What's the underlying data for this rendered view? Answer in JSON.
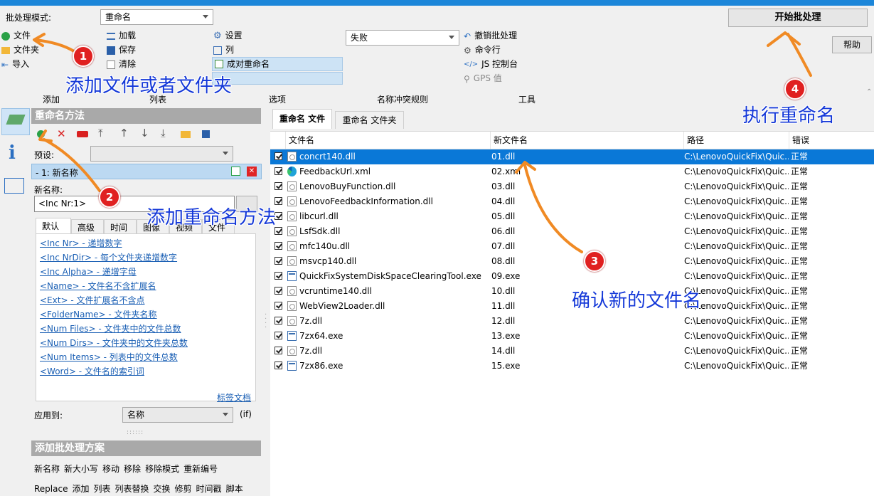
{
  "ribbon": {
    "batch_mode_label": "批处理模式:",
    "batch_mode_value": "重命名",
    "add_group": {
      "items": [
        "文件",
        "文件夹",
        "导入"
      ],
      "caption": "添加"
    },
    "list_group": {
      "items": [
        "加载",
        "保存",
        "清除"
      ],
      "caption": "列表"
    },
    "options_group": {
      "items": [
        "设置",
        "列",
        "成对重命名"
      ],
      "caption": "选项"
    },
    "conflict_group": {
      "value": "失败",
      "caption": "名称冲突规则"
    },
    "tools_group": {
      "items": [
        "撤销批处理",
        "命令行",
        "JS 控制台",
        "GPS 值"
      ],
      "caption": "工具"
    },
    "start_button": "开始批处理",
    "help_button": "帮助"
  },
  "methods": {
    "title": "重命名方法",
    "preset_label": "预设:",
    "method_item": "-  1: 新名称",
    "new_name_label": "新名称:",
    "new_name_value": "<Inc Nr:1>",
    "tabs": [
      "默认",
      "高级",
      "时间",
      "图像",
      "视频",
      "文件"
    ],
    "tags": [
      "<Inc Nr> - 递增数字",
      "<Inc NrDir> - 每个文件夹递增数字",
      "<Inc Alpha> - 递增字母",
      "<Name> - 文件名不含扩展名",
      "<Ext> - 文件扩展名不含点",
      "<FolderName> - 文件夹名称",
      "<Num Files> - 文件夹中的文件总数",
      "<Num Dirs> - 文件夹中的文件夹总数",
      "<Num Items> - 列表中的文件总数",
      "<Word> - 文件名的索引词"
    ],
    "tag_docs": "标签文档",
    "apply_to_label": "应用到:",
    "apply_to_value": "名称",
    "if_label": "(if)"
  },
  "schemes": {
    "title": "添加批处理方案",
    "row1": [
      "新名称",
      "新大小写",
      "移动",
      "移除",
      "移除模式",
      "重新编号"
    ],
    "row2": [
      "Replace",
      "添加",
      "列表",
      "列表替换",
      "交换",
      "修剪",
      "时间戳",
      "脚本"
    ]
  },
  "file_tabs": [
    "重命名 文件",
    "重命名 文件夹"
  ],
  "table": {
    "headers": [
      "文件名",
      "新文件名",
      "路径",
      "错误"
    ],
    "rows": [
      {
        "name": "concrt140.dll",
        "new": "01.dll",
        "path": "C:\\LenovoQuickFix\\Quic...",
        "err": "正常",
        "icon": "dll"
      },
      {
        "name": "FeedbackUrl.xml",
        "new": "02.xml",
        "path": "C:\\LenovoQuickFix\\Quic...",
        "err": "正常",
        "icon": "edge"
      },
      {
        "name": "LenovoBuyFunction.dll",
        "new": "03.dll",
        "path": "C:\\LenovoQuickFix\\Quic...",
        "err": "正常",
        "icon": "dll"
      },
      {
        "name": "LenovoFeedbackInformation.dll",
        "new": "04.dll",
        "path": "C:\\LenovoQuickFix\\Quic...",
        "err": "正常",
        "icon": "dll"
      },
      {
        "name": "libcurl.dll",
        "new": "05.dll",
        "path": "C:\\LenovoQuickFix\\Quic...",
        "err": "正常",
        "icon": "dll"
      },
      {
        "name": "LsfSdk.dll",
        "new": "06.dll",
        "path": "C:\\LenovoQuickFix\\Quic...",
        "err": "正常",
        "icon": "dll"
      },
      {
        "name": "mfc140u.dll",
        "new": "07.dll",
        "path": "C:\\LenovoQuickFix\\Quic...",
        "err": "正常",
        "icon": "dll"
      },
      {
        "name": "msvcp140.dll",
        "new": "08.dll",
        "path": "C:\\LenovoQuickFix\\Quic...",
        "err": "正常",
        "icon": "dll"
      },
      {
        "name": "QuickFixSystemDiskSpaceClearingTool.exe",
        "new": "09.exe",
        "path": "C:\\LenovoQuickFix\\Quic...",
        "err": "正常",
        "icon": "exe"
      },
      {
        "name": "vcruntime140.dll",
        "new": "10.dll",
        "path": "C:\\LenovoQuickFix\\Quic...",
        "err": "正常",
        "icon": "dll"
      },
      {
        "name": "WebView2Loader.dll",
        "new": "11.dll",
        "path": "C:\\LenovoQuickFix\\Quic...",
        "err": "正常",
        "icon": "dll"
      },
      {
        "name": "7z.dll",
        "new": "12.dll",
        "path": "C:\\LenovoQuickFix\\Quic...",
        "err": "正常",
        "icon": "dll"
      },
      {
        "name": "7zx64.exe",
        "new": "13.exe",
        "path": "C:\\LenovoQuickFix\\Quic...",
        "err": "正常",
        "icon": "exe"
      },
      {
        "name": "7z.dll",
        "new": "14.dll",
        "path": "C:\\LenovoQuickFix\\Quic...",
        "err": "正常",
        "icon": "dll"
      },
      {
        "name": "7zx86.exe",
        "new": "15.exe",
        "path": "C:\\LenovoQuickFix\\Quic...",
        "err": "正常",
        "icon": "exe"
      }
    ]
  },
  "annotations": {
    "a1": "添加文件或者文件夹",
    "a2": "添加重命名方法",
    "a3": "确认新的文件名",
    "a4": "执行重命名",
    "badges": [
      "1",
      "2",
      "3",
      "4"
    ]
  },
  "colors": {
    "accent": "#1c86d9",
    "selection": "#0a78d7",
    "annotation": "#1438d8",
    "badge": "#e02020",
    "arrow": "#f08a24"
  }
}
